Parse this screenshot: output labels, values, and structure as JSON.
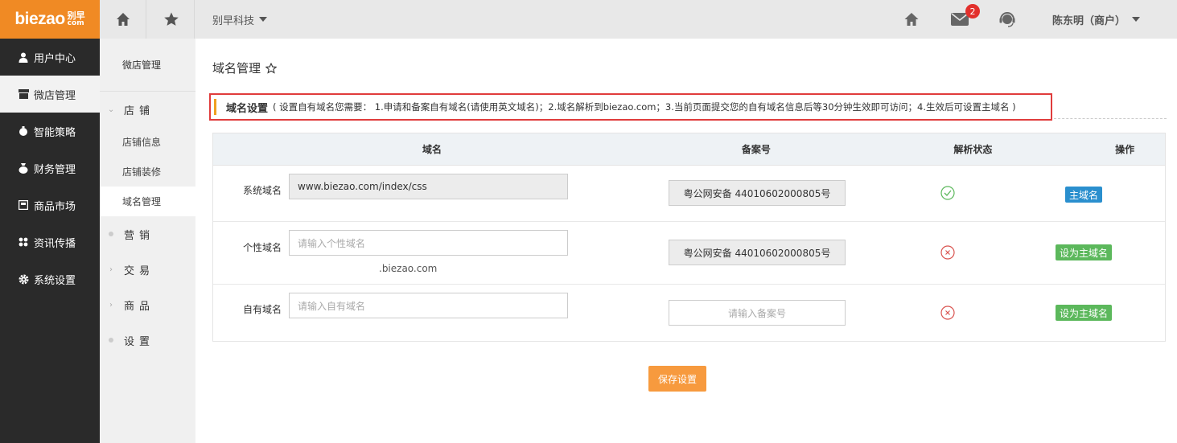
{
  "brand": {
    "logo_en": "biezao",
    "logo_cn": "别早",
    "logo_domain": "com"
  },
  "header": {
    "company": "别早科技",
    "mail_badge": "2",
    "user": "陈东明（商户）"
  },
  "sidebar": {
    "items": [
      {
        "label": "用户中心",
        "icon": "user-icon"
      },
      {
        "label": "微店管理",
        "icon": "store-icon",
        "active": true
      },
      {
        "label": "智能策略",
        "icon": "strategy-icon"
      },
      {
        "label": "财务管理",
        "icon": "money-bag-icon"
      },
      {
        "label": "商品市场",
        "icon": "market-icon"
      },
      {
        "label": "资讯传播",
        "icon": "grid-icon"
      },
      {
        "label": "系统设置",
        "icon": "gear-icon"
      }
    ]
  },
  "subsidebar": {
    "title": "微店管理",
    "groups": {
      "shop": "店铺",
      "marketing": "营销",
      "trade": "交易",
      "goods": "商品",
      "settings": "设置"
    },
    "links": {
      "shop_info": "店铺信息",
      "shop_decor": "店铺装修",
      "domain_mgmt": "域名管理"
    }
  },
  "page": {
    "title": "域名管理",
    "notice_title": "域名设置",
    "notice_text": "( 设置自有域名您需要： 1.申请和备案自有域名(请使用英文域名)；2.域名解析到biezao.com；3.当前页面提交您的自有域名信息后等30分钟生效即可访问；4.生效后可设置主域名 )"
  },
  "table": {
    "headers": {
      "domain": "域名",
      "beian": "备案号",
      "status": "解析状态",
      "action": "操作"
    },
    "rows": {
      "system": {
        "label": "系统域名",
        "value": "www.biezao.com/index/css",
        "beian": "粤公网安备 44010602000805号",
        "status": "ok",
        "action": "主域名"
      },
      "custom": {
        "label": "个性域名",
        "placeholder": "请输入个性域名",
        "suffix": ".biezao.com",
        "beian": "粤公网安备 44010602000805号",
        "status": "error",
        "action": "设为主域名"
      },
      "own": {
        "label": "自有域名",
        "placeholder": "请输入自有域名",
        "beian_placeholder": "请输入备案号",
        "status": "error",
        "action": "设为主域名"
      }
    }
  },
  "save_label": "保存设置",
  "colors": {
    "brand_orange": "#f08a24",
    "notice_border": "#e03c3c",
    "primary_blue": "#2a8fce",
    "success_green": "#5cb85c",
    "save_orange": "#f79a3e"
  }
}
